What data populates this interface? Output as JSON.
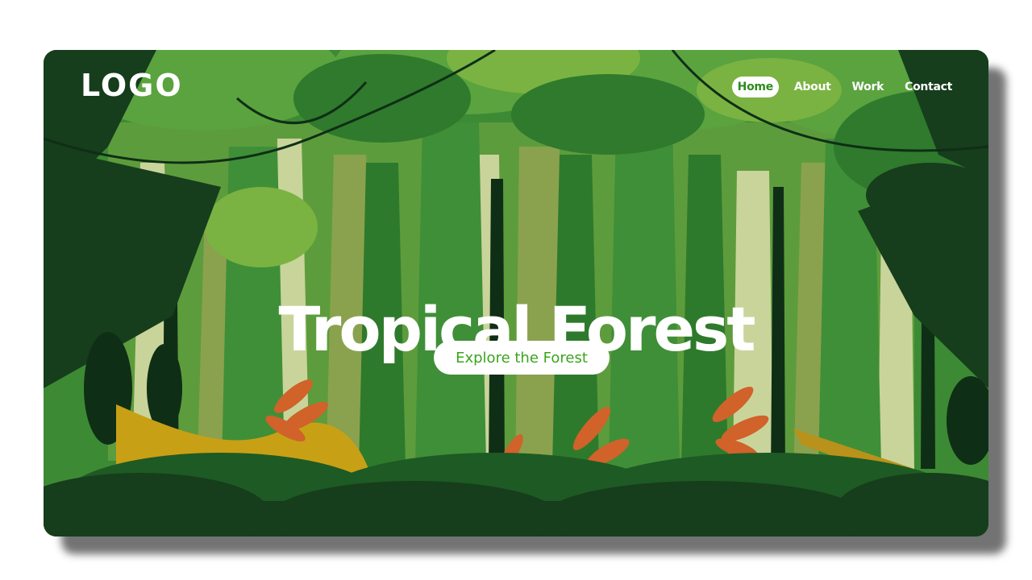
{
  "header": {
    "logo_text": "LOGO",
    "nav": [
      "Home",
      "About",
      "Work",
      "Contact"
    ],
    "active_nav": "Home"
  },
  "hero": {
    "title": "Tropical Forest",
    "cta_label": "Explore the Forest"
  },
  "colors": {
    "accent_green": "#3aa51c",
    "forest_dark": "#163d1c",
    "forest_mid": "#2f7a2c",
    "forest_light": "#7ab342",
    "trunk_pale": "#c9d49a",
    "leaf_orange": "#d0622a",
    "path_gold": "#c8a016"
  }
}
